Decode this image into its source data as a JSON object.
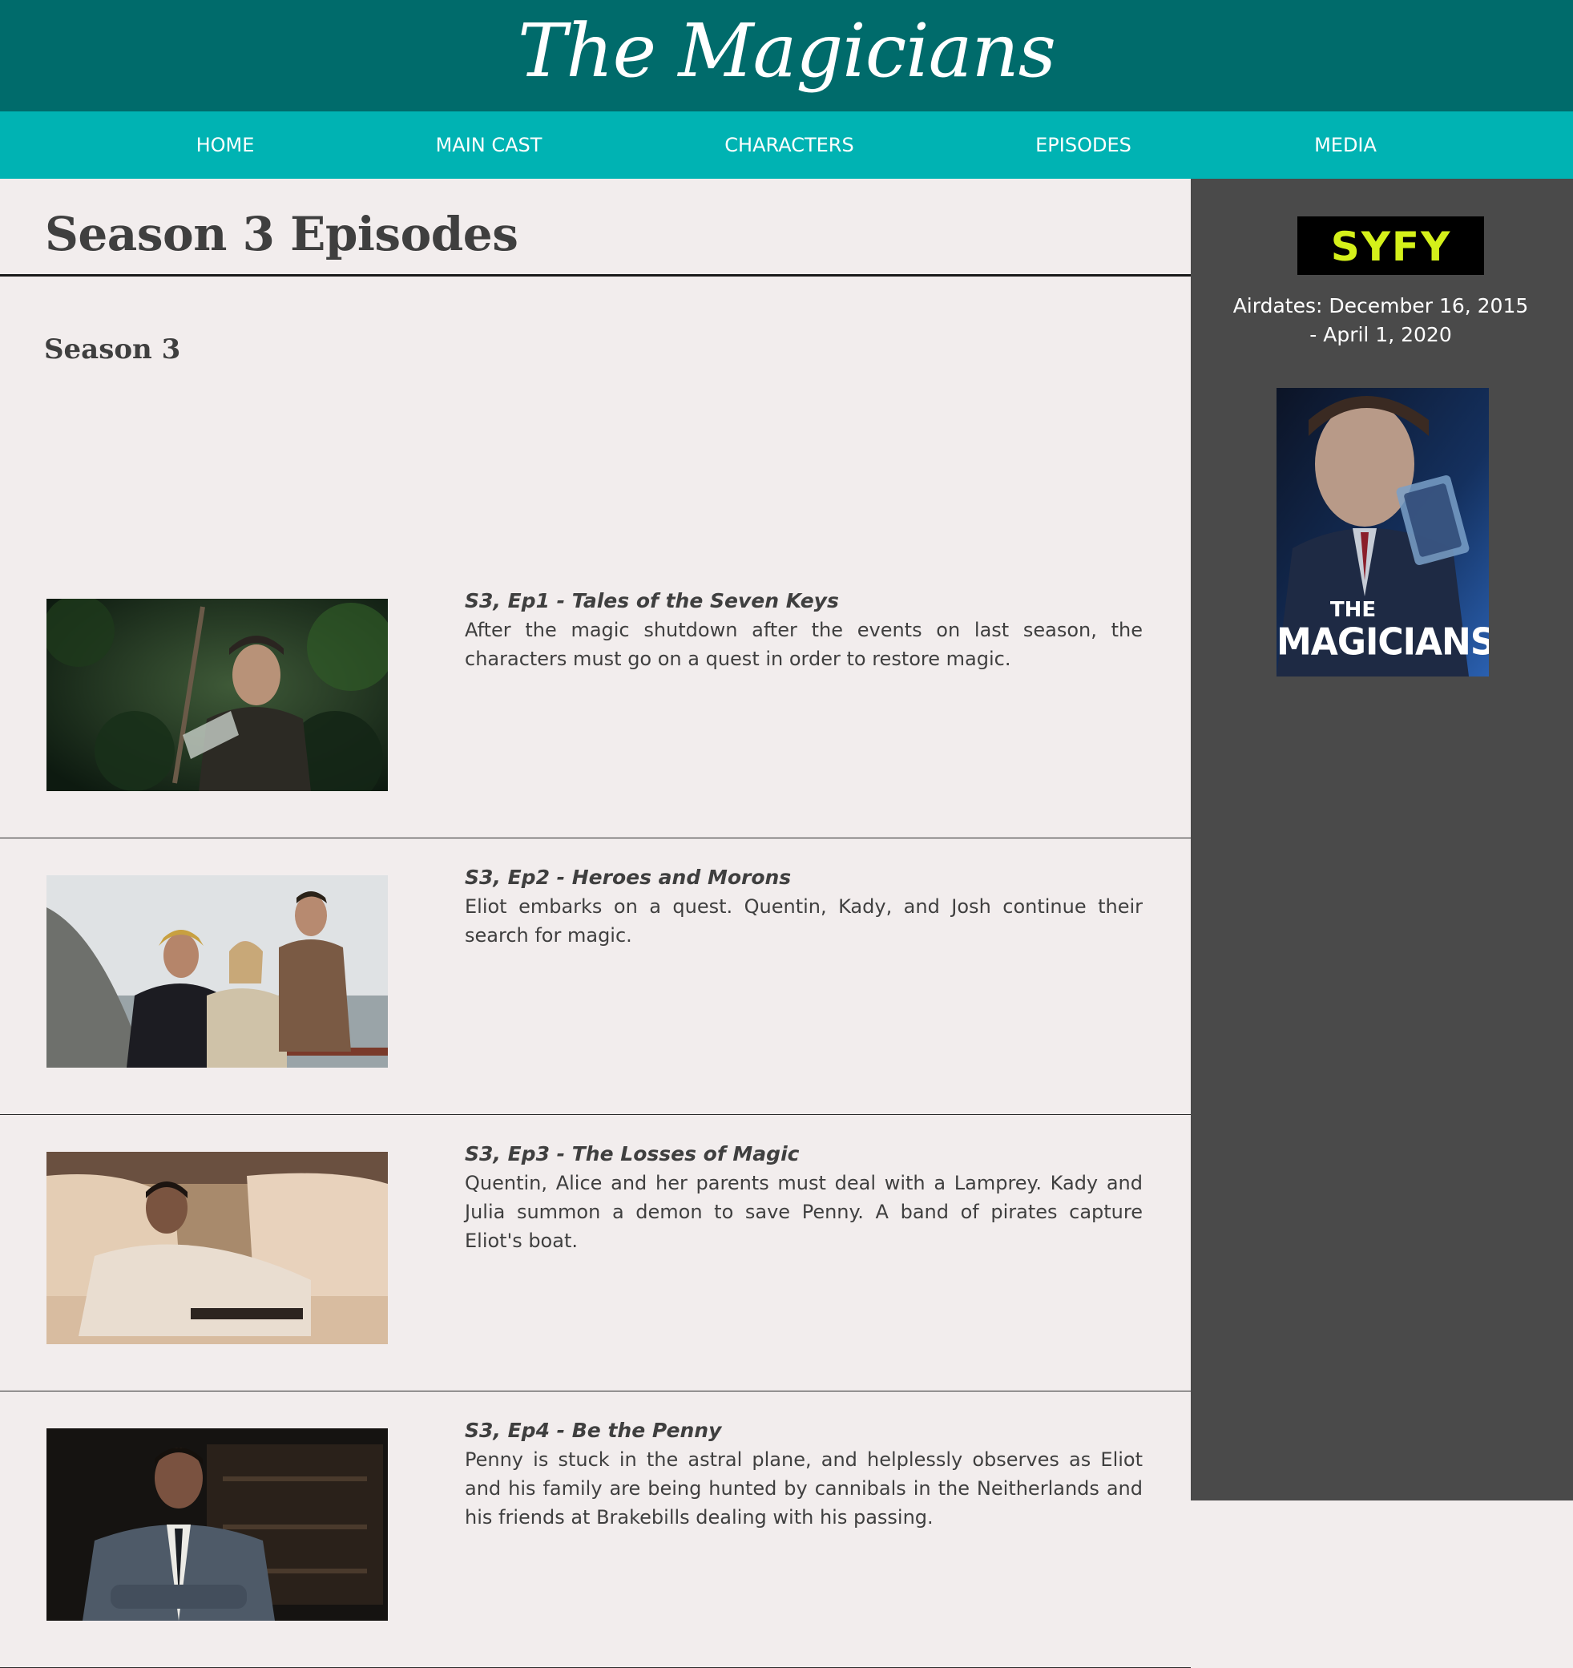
{
  "site": {
    "title": "The Magicians"
  },
  "nav": {
    "items": [
      "HOME",
      "MAIN CAST",
      "CHARACTERS",
      "EPISODES",
      "MEDIA"
    ]
  },
  "main": {
    "page_title": "Season 3 Episodes",
    "season_heading": "Season 3",
    "episodes": [
      {
        "title": "S3, Ep1 - Tales of the Seven Keys",
        "description": "After the magic shutdown after the events on last season, the characters must go on a quest in order to restore magic."
      },
      {
        "title": "S3, Ep2 - Heroes and Morons",
        "description": "Eliot embarks on a quest. Quentin, Kady, and Josh continue their search for magic."
      },
      {
        "title": "S3, Ep3 - The Losses of Magic",
        "description": "Quentin, Alice and her parents must deal with a Lamprey. Kady and Julia summon a demon to save Penny. A band of pirates capture Eliot's boat."
      },
      {
        "title": "S3, Ep4 - Be the Penny",
        "description": "Penny is stuck in the astral plane, and helplessly observes as Eliot and his family are being hunted by cannibals in the Neitherlands and his friends at Brakebills dealing with his passing."
      }
    ]
  },
  "sidebar": {
    "network_logo_text": "SYFY",
    "airdates": "Airdates: December 16, 2015 - April 1, 2020",
    "poster_title_line1": "THE",
    "poster_title_line2": "MAGICIANS"
  },
  "colors": {
    "header_bg": "#006b6b",
    "nav_bg": "#00b3b3",
    "main_bg": "#f2eded",
    "sidebar_bg": "#4a4a4a",
    "syfy_yellow": "#d4f01a"
  }
}
